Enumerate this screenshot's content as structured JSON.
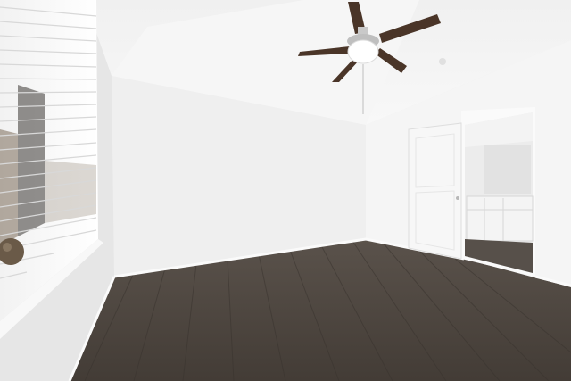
{
  "scene": {
    "ceiling_color": "#f4f4f4",
    "back_wall_color": "#f1f1f1",
    "right_wall_color": "#f6f6f6",
    "left_wall_color": "#e9e9e9",
    "floor_color": "#4d4640",
    "floor_plank_line_color": "#3a342f",
    "trim_color": "#fafafa",
    "door_color": "#f7f7f7",
    "fan_blade_color": "#4a3528"
  }
}
